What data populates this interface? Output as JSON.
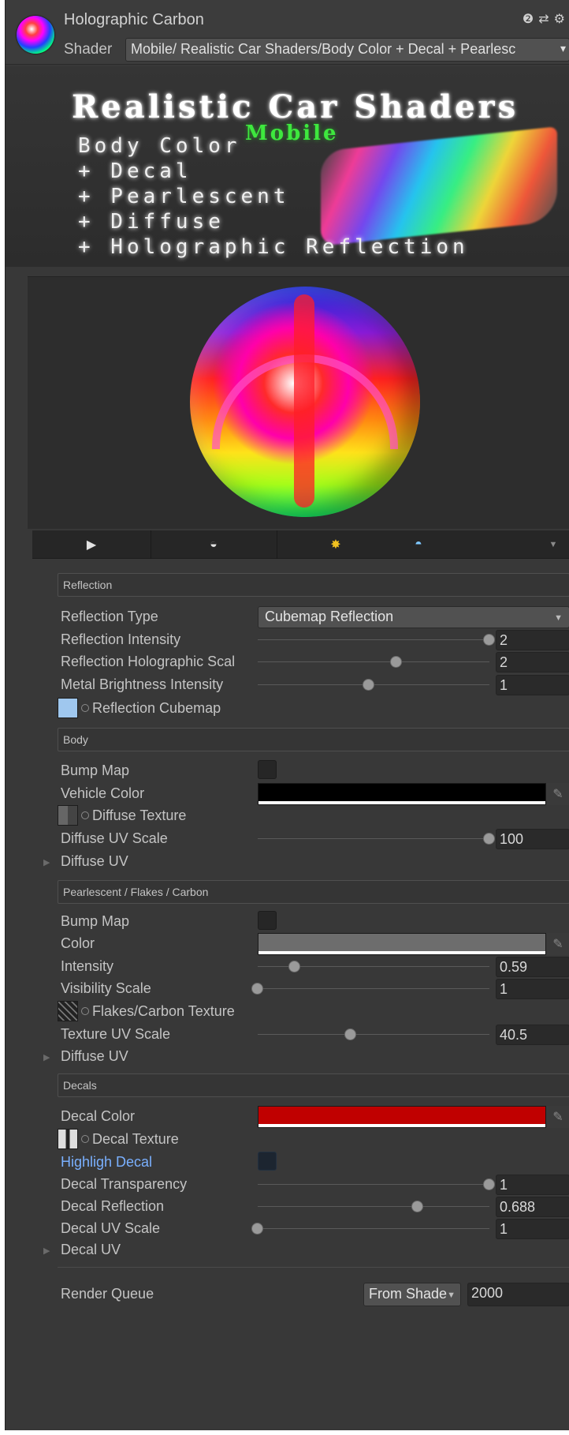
{
  "header": {
    "material_name": "Holographic Carbon",
    "shader_label": "Shader",
    "shader_value": "Mobile/ Realistic Car Shaders/Body Color + Decal + Pearlesc",
    "icons": [
      "help-icon",
      "preset-icon",
      "gear-icon"
    ]
  },
  "banner": {
    "title": "Realistic Car Shaders",
    "subtitle": "Mobile",
    "lines": [
      "Body Color",
      "+ Decal",
      "+ Pearlescent",
      "+ Diffuse",
      "+ Holographic Reflection"
    ]
  },
  "preview_toolbar": {
    "icons": [
      "play-icon",
      "sphere-icon",
      "light-icon",
      "skybox-sphere-icon",
      "dropdown-arrow-icon"
    ]
  },
  "sections": {
    "reflection": {
      "title": "Reflection",
      "reflection_type_label": "Reflection Type",
      "reflection_type_value": "Cubemap Reflection",
      "reflection_intensity_label": "Reflection Intensity",
      "reflection_intensity_value": "2",
      "reflection_intensity_fraction": 1.0,
      "holo_scale_label": "Reflection Holographic Scal",
      "holo_scale_value": "2",
      "holo_scale_fraction": 0.6,
      "metal_brightness_label": "Metal Brightness Intensity",
      "metal_brightness_value": "1",
      "metal_brightness_fraction": 0.48,
      "cubemap_label": "Reflection Cubemap"
    },
    "body": {
      "title": "Body",
      "bump_label": "Bump Map",
      "vehicle_color_label": "Vehicle Color",
      "vehicle_color": "#000000",
      "diffuse_texture_label": "Diffuse Texture",
      "diffuse_uv_scale_label": "Diffuse UV Scale",
      "diffuse_uv_scale_value": "100",
      "diffuse_uv_scale_fraction": 1.0,
      "diffuse_uv_label": "Diffuse UV"
    },
    "pearlescent": {
      "title": "Pearlescent / Flakes / Carbon",
      "bump_label": "Bump Map",
      "color_label": "Color",
      "color": "#6d6d6d",
      "intensity_label": "Intensity",
      "intensity_value": "0.59",
      "intensity_fraction": 0.16,
      "visibility_label": "Visibility Scale",
      "visibility_value": "1",
      "visibility_fraction": 0.0,
      "flakes_texture_label": "Flakes/Carbon Texture",
      "texture_uv_scale_label": "Texture UV Scale",
      "texture_uv_scale_value": "40.5",
      "texture_uv_scale_fraction": 0.4,
      "diffuse_uv_label": "Diffuse UV"
    },
    "decals": {
      "title": "Decals",
      "decal_color_label": "Decal Color",
      "decal_color": "#c00000",
      "decal_texture_label": "Decal Texture",
      "highlight_label": "Highligh Decal",
      "transparency_label": "Decal Transparency",
      "transparency_value": "1",
      "transparency_fraction": 1.0,
      "reflection_label": "Decal Reflection",
      "reflection_value": "0.688",
      "reflection_fraction": 0.69,
      "uv_scale_label": "Decal UV Scale",
      "uv_scale_value": "1",
      "uv_scale_fraction": 0.0,
      "decal_uv_label": "Decal UV"
    }
  },
  "render_queue": {
    "label": "Render Queue",
    "mode": "From Shade",
    "value": "2000"
  }
}
